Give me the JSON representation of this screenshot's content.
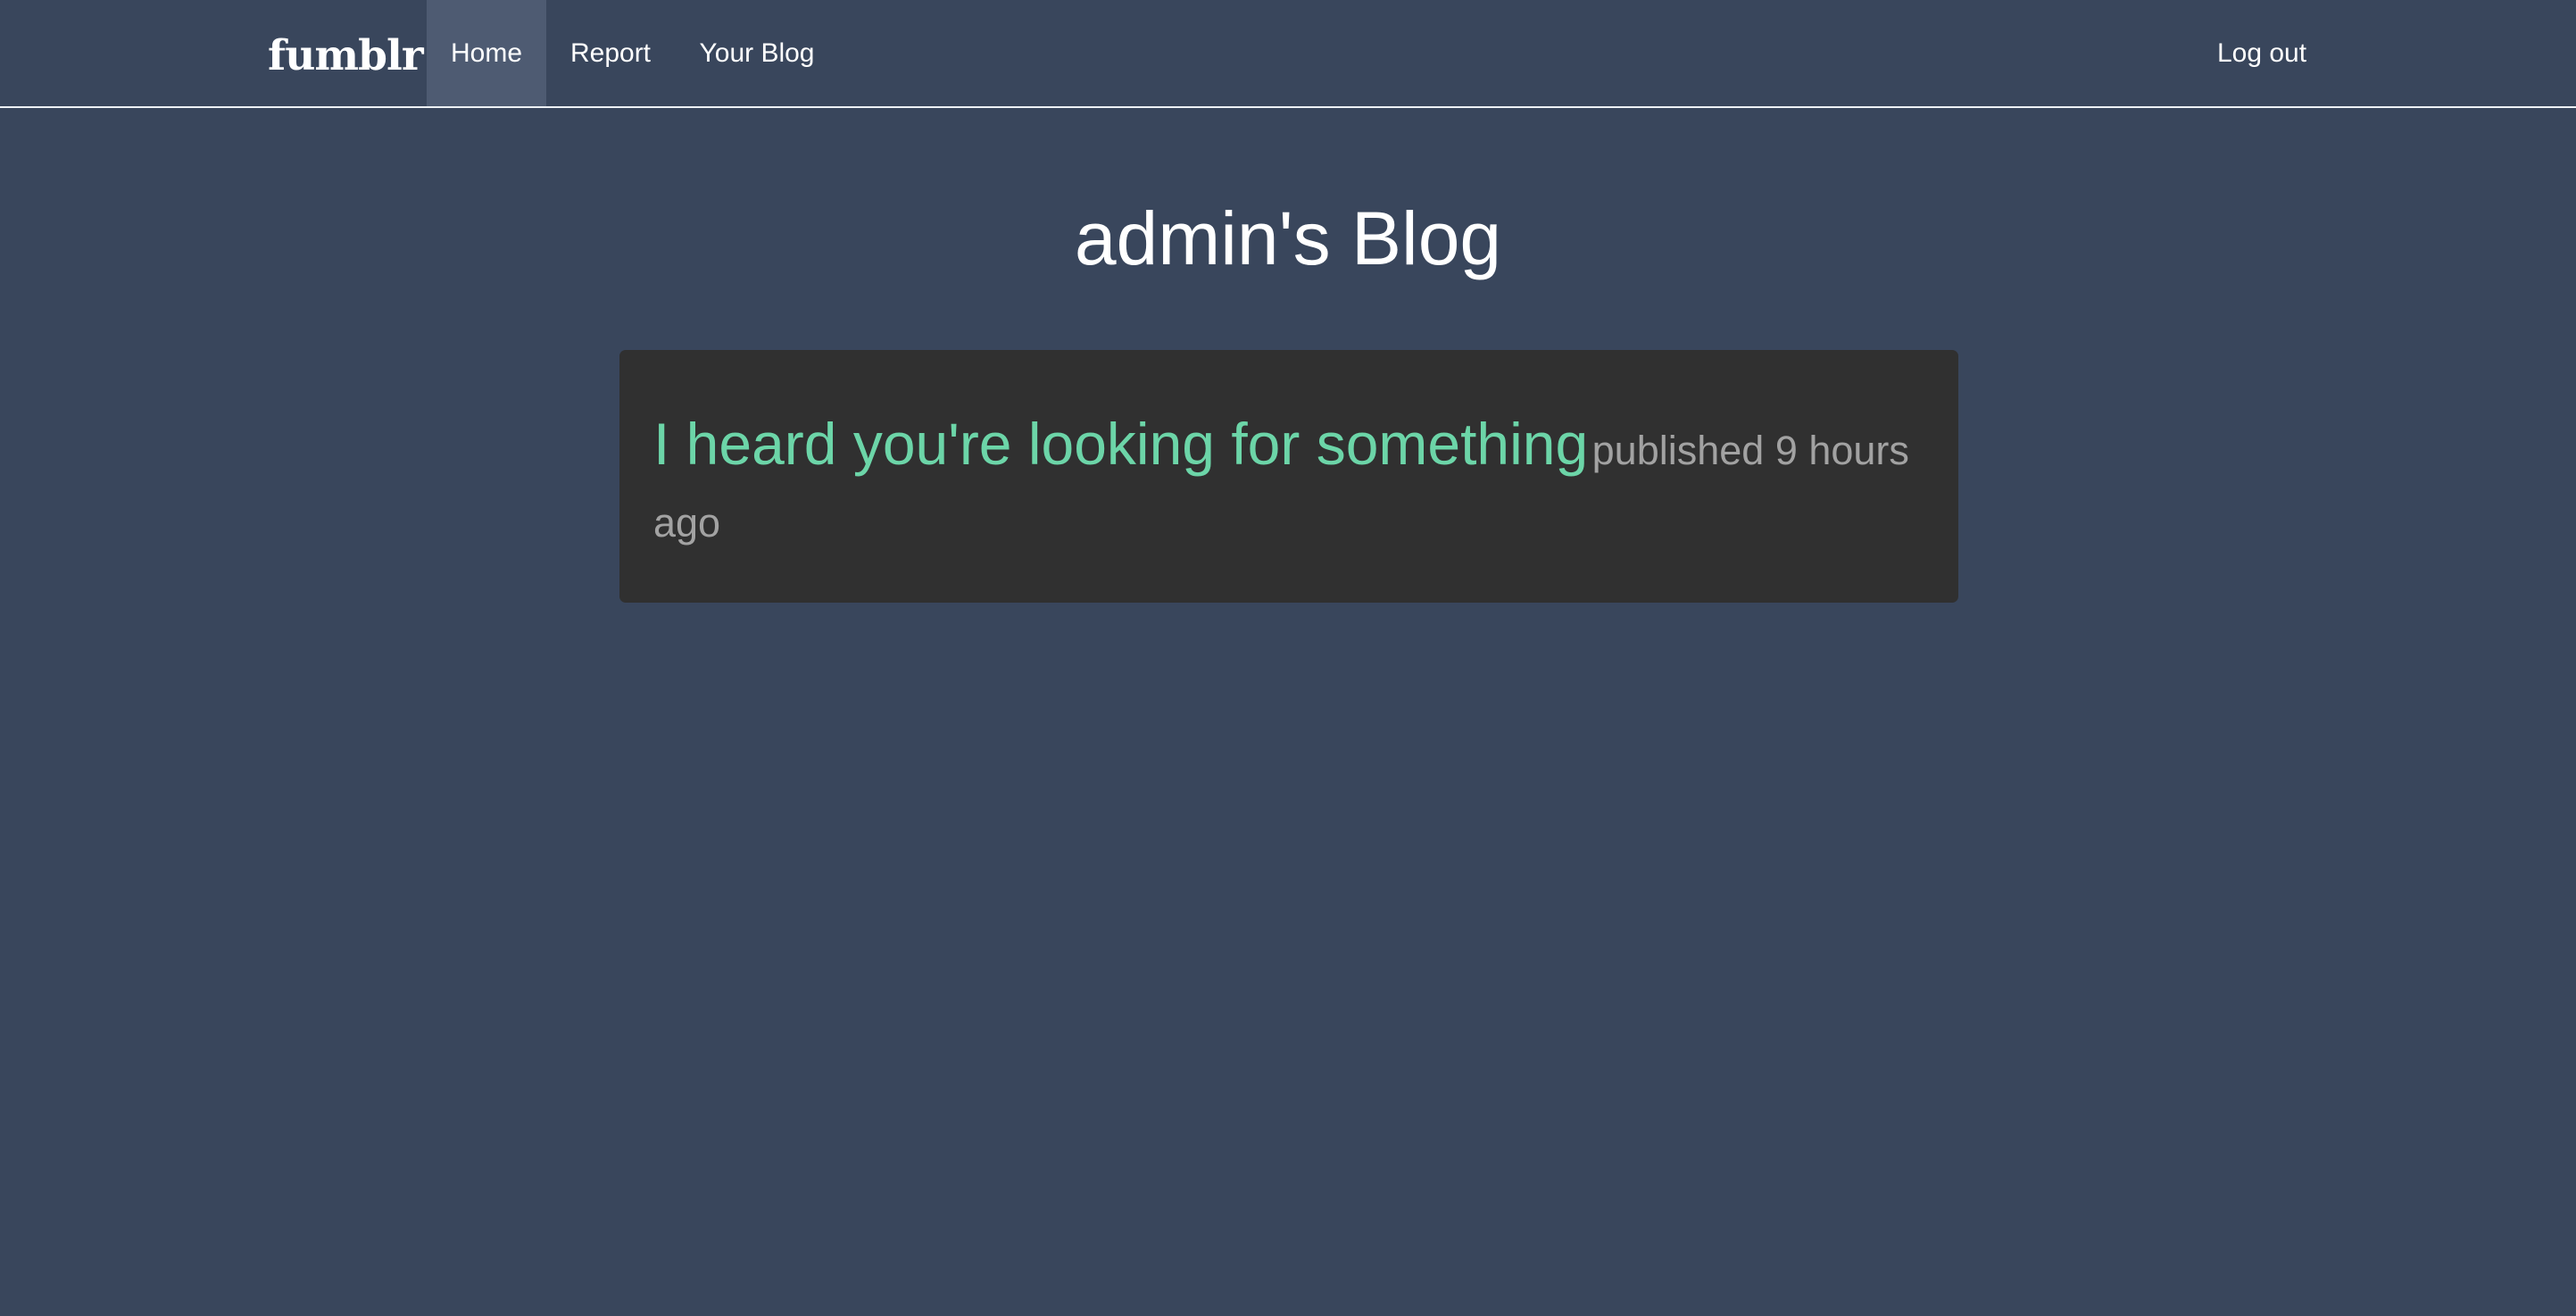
{
  "navbar": {
    "brand": "fumblr",
    "items": [
      {
        "label": "Home",
        "active": true
      },
      {
        "label": "Report",
        "active": false
      },
      {
        "label": "Your Blog",
        "active": false
      }
    ],
    "logout_label": "Log out"
  },
  "page": {
    "title": "admin's Blog"
  },
  "posts": [
    {
      "title": "I heard you're looking for something",
      "meta": "published 9 hours ago"
    }
  ],
  "colors": {
    "background": "#39465c",
    "nav_active": "#4e5b72",
    "card": "#303030",
    "post_title": "#6cd5a8",
    "post_meta": "#a2a2a2"
  }
}
